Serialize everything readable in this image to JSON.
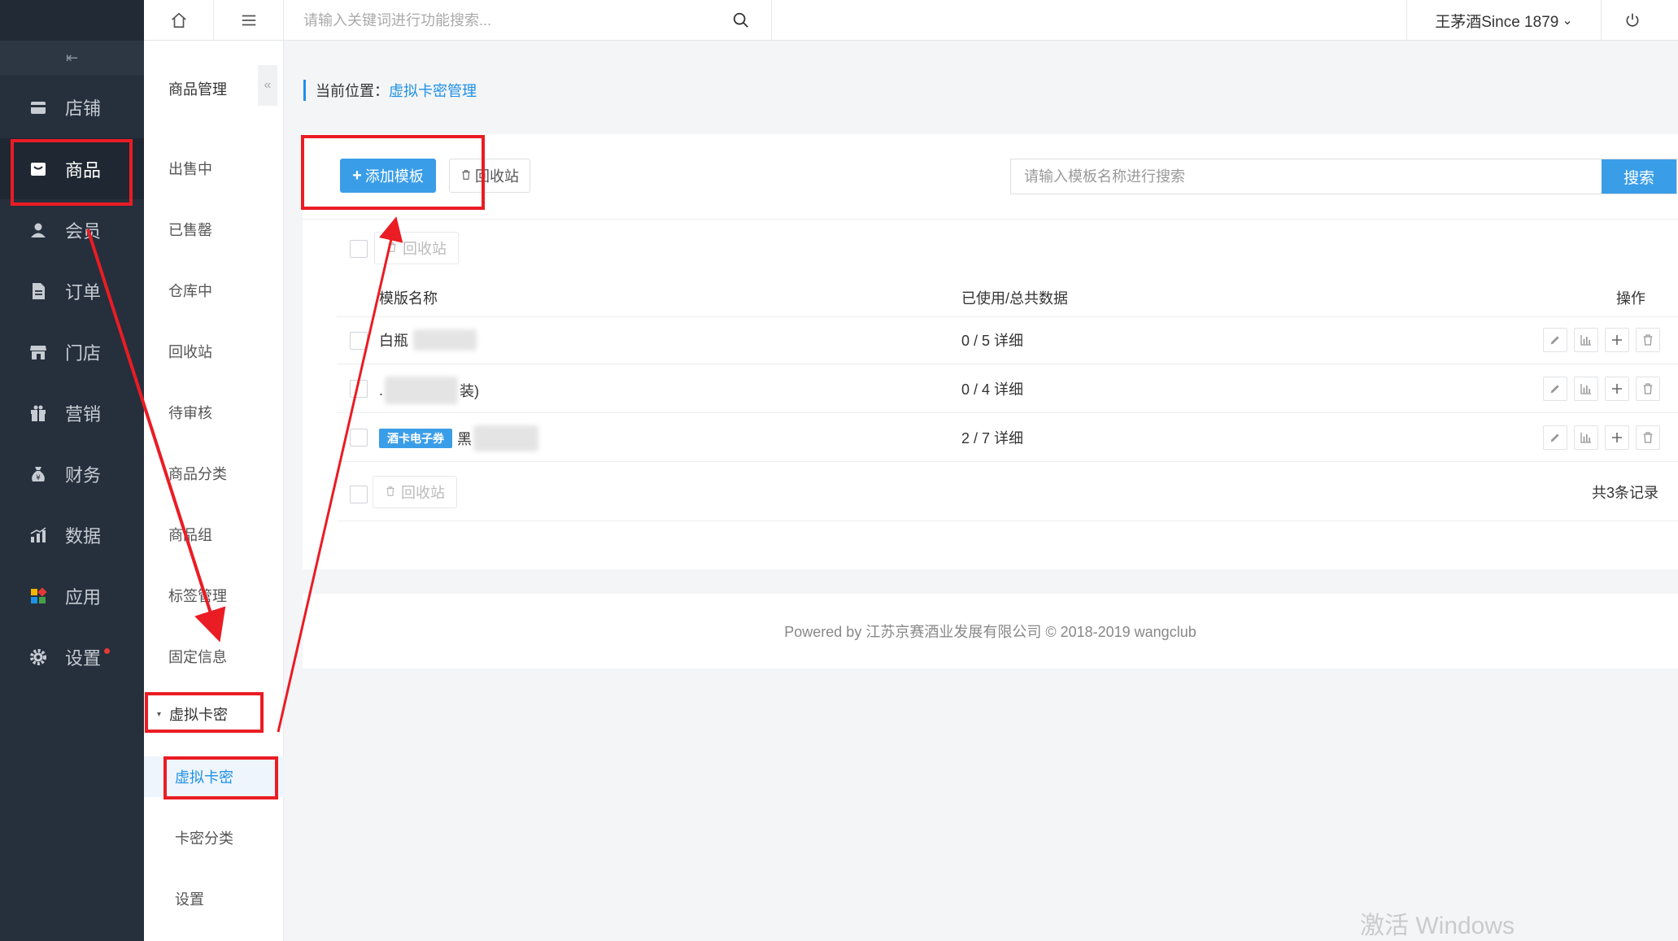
{
  "sidebar": {
    "collapse_icon": "collapse-menu-icon",
    "items": [
      {
        "label": "店铺",
        "icon": "store-icon"
      },
      {
        "label": "商品",
        "icon": "goods-icon"
      },
      {
        "label": "会员",
        "icon": "member-icon"
      },
      {
        "label": "订单",
        "icon": "order-icon"
      },
      {
        "label": "门店",
        "icon": "shop-icon"
      },
      {
        "label": "营销",
        "icon": "gift-icon"
      },
      {
        "label": "财务",
        "icon": "money-bag-icon"
      },
      {
        "label": "数据",
        "icon": "bar-chart-icon"
      },
      {
        "label": "应用",
        "icon": "apps-icon"
      },
      {
        "label": "设置",
        "icon": "gear-icon"
      }
    ],
    "active": "商品"
  },
  "submenu": {
    "title": "商品管理",
    "collapse_label": "«",
    "items": [
      "出售中",
      "已售罄",
      "仓库中",
      "回收站",
      "待审核",
      "商品分类",
      "商品组",
      "标签管理",
      "固定信息"
    ],
    "group": {
      "caret": "▾",
      "label": "虚拟卡密",
      "children": [
        "虚拟卡密",
        "卡密分类",
        "设置"
      ],
      "active": "虚拟卡密"
    }
  },
  "topbar": {
    "search_placeholder": "请输入关键词进行功能搜索...",
    "user": "王茅酒Since 1879",
    "user_caret": "⌄"
  },
  "breadcrumb": {
    "label": "当前位置：",
    "current": "虚拟卡密管理"
  },
  "toolbar": {
    "add_label": "添加模板",
    "recycle_label": "回收站",
    "search_placeholder": "请输入模板名称进行搜索",
    "search_button": "搜索"
  },
  "table": {
    "bulk_recycle": "回收站",
    "headers": {
      "name": "模版名称",
      "usage": "已使用/总共数据",
      "ops": "操作"
    },
    "rows": [
      {
        "name": "白瓶",
        "tag": "",
        "name_suffix": "",
        "usage": "0 / 5 详细"
      },
      {
        "name": ".",
        "tag": "",
        "name_suffix": "装)",
        "usage": "0 / 4 详细"
      },
      {
        "name": "黑",
        "tag": "酒卡电子券",
        "name_suffix": "",
        "usage": "2 / 7 详细"
      }
    ],
    "op_icons": [
      "edit-icon",
      "stats-icon",
      "plus-icon",
      "trash-icon"
    ],
    "total": "共3条记录"
  },
  "footer": {
    "text": "Powered by 江苏京赛酒业发展有限公司 © 2018-2019 wangclub"
  },
  "watermark": "激活 Windows",
  "colors": {
    "sidebar_bg": "#262f3c",
    "accent": "#3a9de8",
    "link": "#1e90e6",
    "annotation": "#ea1c24"
  }
}
